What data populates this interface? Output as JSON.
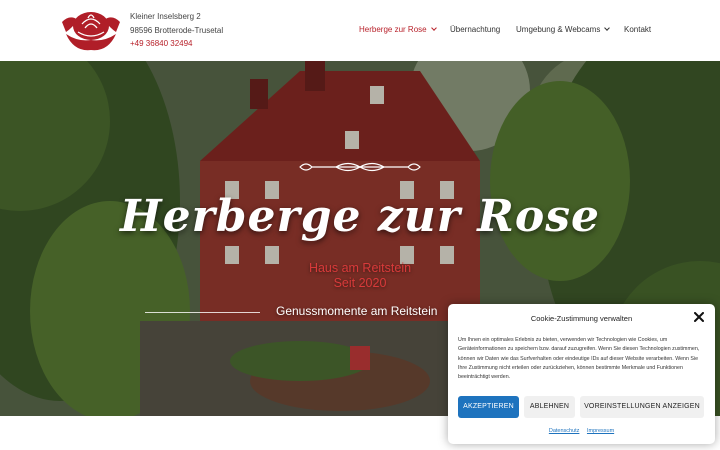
{
  "header": {
    "logo_icon": "rose-logo-icon",
    "address_line1": "Kleiner Inselsberg 2",
    "address_line2": "98596 Brotterode-Trusetal",
    "phone": "+49 36840 32494",
    "nav": [
      {
        "label": "Herberge zur Rose",
        "active": true,
        "has_dropdown": true
      },
      {
        "label": "Übernachtung",
        "active": false,
        "has_dropdown": false
      },
      {
        "label": "Umgebung & Webcams",
        "active": false,
        "has_dropdown": true
      },
      {
        "label": "Kontakt",
        "active": false,
        "has_dropdown": false
      }
    ]
  },
  "hero": {
    "title": "Herberge zur Rose",
    "subtitle1": "Haus am Reitstein",
    "subtitle2": "Seit 2020",
    "tagline": "Genussmomente am Reitstein",
    "ornament_icon": "ornament-divider-icon"
  },
  "cookie": {
    "title": "Cookie-Zustimmung verwalten",
    "close_icon": "close-icon",
    "text": "Um Ihnen ein optimales Erlebnis zu bieten, verwenden wir Technologien wie Cookies, um Geräteinformationen zu speichern bzw. darauf zuzugreifen. Wenn Sie diesen Technologien zustimmen, können wir Daten wie das Surfverhalten oder eindeutige IDs auf dieser Website verarbeiten. Wenn Sie Ihre Zustimmung nicht erteilen oder zurückziehen, können bestimmte Merkmale und Funktionen beeinträchtigt werden.",
    "accept_label": "AKZEPTIEREN",
    "deny_label": "ABLEHNEN",
    "preferences_label": "VOREINSTELLUNGEN ANZEIGEN",
    "link_privacy": "Datenschutz",
    "link_imprint": "Impressum"
  },
  "colors": {
    "accent_red": "#b8222b",
    "button_blue": "#1e73be"
  }
}
